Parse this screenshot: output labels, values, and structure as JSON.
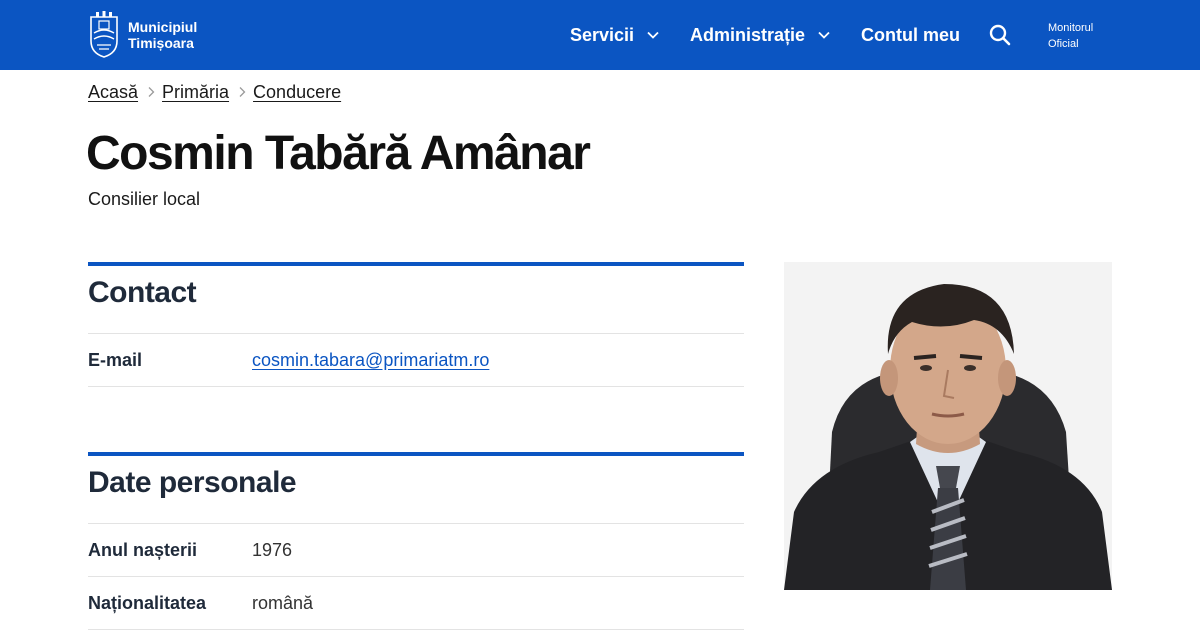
{
  "header": {
    "logo_line1": "Municipiul",
    "logo_line2": "Timișoara",
    "nav": [
      {
        "label": "Servicii"
      },
      {
        "label": "Administrație"
      },
      {
        "label": "Contul meu"
      }
    ],
    "search_icon": "search-icon",
    "monitor_line1": "Monitorul",
    "monitor_line2": "Oficial"
  },
  "breadcrumb": [
    "Acasă",
    "Primăria",
    "Conducere"
  ],
  "page": {
    "title": "Cosmin Tabără Amânar",
    "subtitle": "Consilier local"
  },
  "contact": {
    "heading": "Contact",
    "email_label": "E-mail",
    "email_value": "cosmin.tabara@primariatm.ro"
  },
  "personal": {
    "heading": "Date personale",
    "rows": [
      {
        "label": "Anul nașterii",
        "value": "1976"
      },
      {
        "label": "Naționalitatea",
        "value": "română"
      }
    ]
  },
  "colors": {
    "brand": "#0b55c2",
    "heading_text": "#1f2a3a",
    "divider": "#e3e3e3"
  }
}
